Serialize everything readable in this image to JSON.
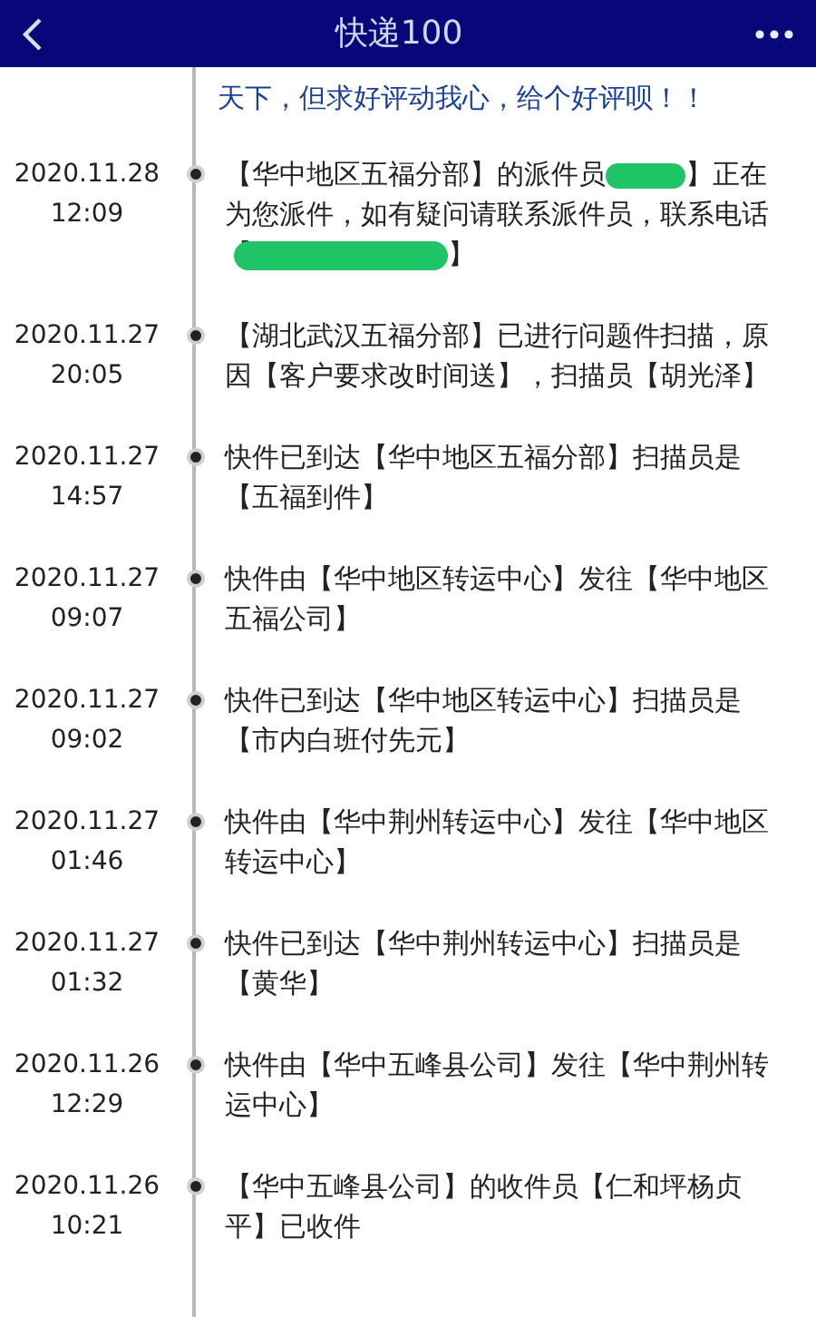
{
  "header": {
    "title": "快递100"
  },
  "notice": "天下，但求好评动我心，给个好评呗！！",
  "events": [
    {
      "date": "2020.11.28",
      "time": "12:09",
      "segments": [
        {
          "kind": "text",
          "text": "【华中地区五福分部】的派件员"
        },
        {
          "kind": "scribble",
          "wide": false
        },
        {
          "kind": "text",
          "text": "】正在为您派件，如有疑问请联系派件员，联系电话【"
        },
        {
          "kind": "scribble",
          "wide": true
        },
        {
          "kind": "text",
          "text": "】"
        }
      ]
    },
    {
      "date": "2020.11.27",
      "time": "20:05",
      "segments": [
        {
          "kind": "text",
          "text": "【湖北武汉五福分部】已进行问题件扫描，原因【客户要求改时间送】，扫描员【胡光泽】"
        }
      ]
    },
    {
      "date": "2020.11.27",
      "time": "14:57",
      "segments": [
        {
          "kind": "text",
          "text": "快件已到达【华中地区五福分部】扫描员是【五福到件】"
        }
      ]
    },
    {
      "date": "2020.11.27",
      "time": "09:07",
      "segments": [
        {
          "kind": "text",
          "text": "快件由【华中地区转运中心】发往【华中地区五福公司】"
        }
      ]
    },
    {
      "date": "2020.11.27",
      "time": "09:02",
      "segments": [
        {
          "kind": "text",
          "text": "快件已到达【华中地区转运中心】扫描员是【市内白班付先元】"
        }
      ]
    },
    {
      "date": "2020.11.27",
      "time": "01:46",
      "segments": [
        {
          "kind": "text",
          "text": "快件由【华中荆州转运中心】发往【华中地区转运中心】"
        }
      ]
    },
    {
      "date": "2020.11.27",
      "time": "01:32",
      "segments": [
        {
          "kind": "text",
          "text": "快件已到达【华中荆州转运中心】扫描员是【黄华】"
        }
      ]
    },
    {
      "date": "2020.11.26",
      "time": "12:29",
      "segments": [
        {
          "kind": "text",
          "text": "快件由【华中五峰县公司】发往【华中荆州转运中心】"
        }
      ]
    },
    {
      "date": "2020.11.26",
      "time": "10:21",
      "segments": [
        {
          "kind": "text",
          "text": "【华中五峰县公司】的收件员【仁和坪杨贞平】已收件"
        }
      ]
    }
  ]
}
